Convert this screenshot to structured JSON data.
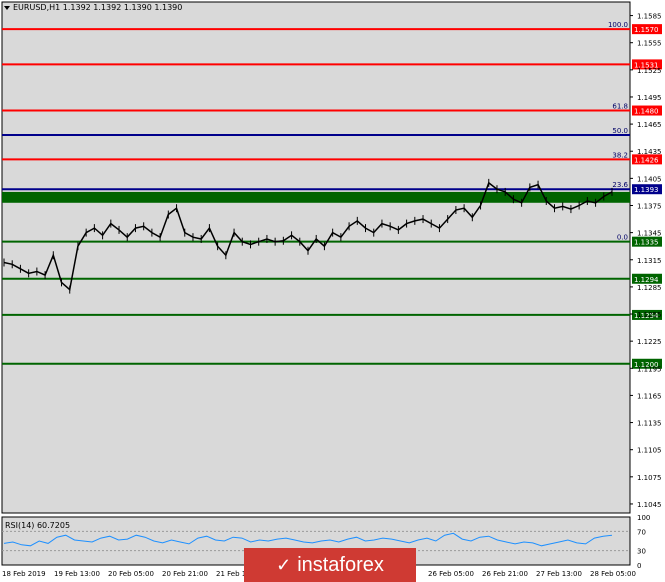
{
  "chart_title": "EURUSD,H1  1.1392 1.1392 1.1390 1.1390",
  "rsi_title": "RSI(14) 60.7205",
  "logo_text": "instaforex",
  "colors": {
    "background": "#d9d9d9",
    "red_level": "#ff0000",
    "green_level": "#006400",
    "blue_level": "#00008b",
    "current_price": "#00008b",
    "rsi_line": "#1e90ff",
    "logo_bg": "#cf3a33"
  },
  "price_axis": {
    "ticks": [
      "1.1585",
      "1.1555",
      "1.1525",
      "1.1495",
      "1.1465",
      "1.1435",
      "1.1405",
      "1.1375",
      "1.1345",
      "1.1315",
      "1.1285",
      "1.1255",
      "1.1225",
      "1.1195",
      "1.1165",
      "1.1135",
      "1.1105",
      "1.1075",
      "1.1045"
    ],
    "range": [
      1.1035,
      1.16
    ]
  },
  "time_axis": [
    "18 Feb 2019",
    "19 Feb 13:00",
    "20 Feb 05:00",
    "20 Feb 21:00",
    "21 Feb 1",
    "26 Feb 05:00",
    "26 Feb 21:00",
    "27 Feb 13:00",
    "28 Feb 05:00"
  ],
  "rsi_axis": {
    "ticks": [
      "100",
      "70",
      "30",
      "0"
    ],
    "range": [
      0,
      100
    ]
  },
  "levels": [
    {
      "price": 1.157,
      "label": "1.1570",
      "fib": "100.0",
      "kind": "red"
    },
    {
      "price": 1.1531,
      "label": "1.1531",
      "fib": "",
      "kind": "red"
    },
    {
      "price": 1.148,
      "label": "1.1480",
      "fib": "61.8",
      "kind": "red"
    },
    {
      "price": 1.1453,
      "label": "",
      "fib": "50.0",
      "kind": "blue"
    },
    {
      "price": 1.1426,
      "label": "1.1426",
      "fib": "38.2",
      "kind": "red"
    },
    {
      "price": 1.1393,
      "label": "1.1393",
      "fib": "23.6",
      "kind": "blue"
    },
    {
      "price": 1.1335,
      "label": "1.1335",
      "fib": "0.0",
      "kind": "green"
    },
    {
      "price": 1.1294,
      "label": "1.1294",
      "fib": "",
      "kind": "green"
    },
    {
      "price": 1.1254,
      "label": "1.1254",
      "fib": "",
      "kind": "green"
    },
    {
      "price": 1.12,
      "label": "1.1200",
      "fib": "",
      "kind": "green"
    }
  ],
  "green_band": {
    "top": 1.139,
    "bottom": 1.1378
  },
  "chart_data": {
    "type": "line",
    "series": [
      {
        "values": [
          1.1312,
          1.131,
          1.1305,
          1.13,
          1.1302,
          1.1298,
          1.132,
          1.129,
          1.1282,
          1.133,
          1.1345,
          1.135,
          1.1342,
          1.1355,
          1.1348,
          1.134,
          1.135,
          1.1352,
          1.1345,
          1.134,
          1.1365,
          1.1372,
          1.1345,
          1.134,
          1.1338,
          1.135,
          1.133,
          1.132,
          1.1345,
          1.1335,
          1.1332,
          1.1335,
          1.1338,
          1.1335,
          1.1336,
          1.1342,
          1.1335,
          1.1325,
          1.1338,
          1.133,
          1.1345,
          1.134,
          1.1352,
          1.1358,
          1.135,
          1.1345,
          1.1355,
          1.1352,
          1.1348,
          1.1355,
          1.1358,
          1.136,
          1.1355,
          1.135,
          1.136,
          1.137,
          1.1372,
          1.1362,
          1.1375,
          1.14,
          1.1393,
          1.139,
          1.1382,
          1.1378,
          1.1395,
          1.1398,
          1.138,
          1.1372,
          1.1374,
          1.1371,
          1.1375,
          1.138,
          1.1378,
          1.1385,
          1.139
        ]
      }
    ],
    "rsi": [
      45,
      48,
      42,
      40,
      50,
      45,
      58,
      62,
      52,
      50,
      48,
      56,
      60,
      52,
      54,
      62,
      58,
      50,
      46,
      52,
      48,
      44,
      56,
      60,
      52,
      50,
      58,
      56,
      48,
      52,
      50,
      54,
      56,
      52,
      48,
      46,
      50,
      52,
      48,
      54,
      58,
      50,
      52,
      56,
      54,
      50,
      46,
      52,
      56,
      50,
      62,
      66,
      54,
      50,
      58,
      60,
      52,
      48,
      44,
      48,
      46,
      40,
      44,
      48,
      52,
      46,
      44,
      56,
      60,
      62
    ]
  }
}
